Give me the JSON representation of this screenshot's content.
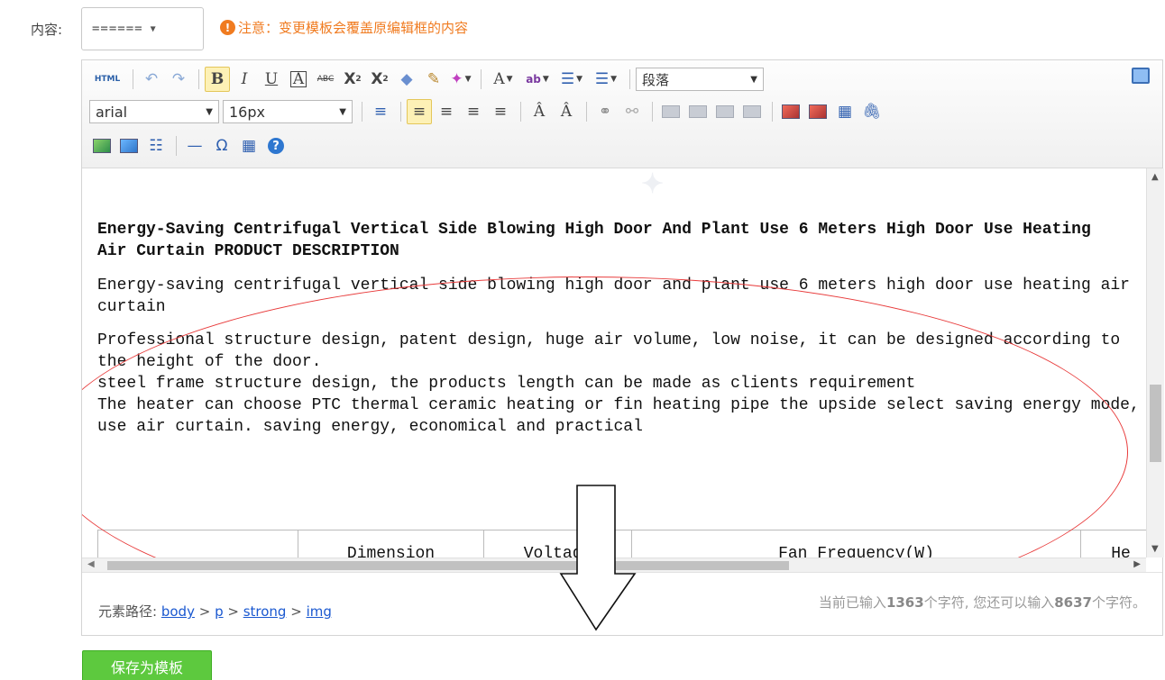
{
  "form": {
    "content_label": "内容:",
    "template_select_value": "======",
    "warning_text": "注意：变更模板会覆盖原编辑框的内容",
    "save_template_button": "保存为模板"
  },
  "toolbar": {
    "row1": [
      {
        "name": "html-source-button",
        "glyph": "HTML"
      },
      {
        "name": "undo-button",
        "glyph": "↶"
      },
      {
        "name": "redo-button",
        "glyph": "↷"
      },
      {
        "name": "bold-button",
        "glyph": "B"
      },
      {
        "name": "italic-button",
        "glyph": "I"
      },
      {
        "name": "underline-button",
        "glyph": "U"
      },
      {
        "name": "font-border-button",
        "glyph": "A"
      },
      {
        "name": "strikethrough-button",
        "glyph": "ABC"
      },
      {
        "name": "superscript-button",
        "glyph": "X²"
      },
      {
        "name": "subscript-button",
        "glyph": "X₂"
      },
      {
        "name": "eraser-button",
        "glyph": "⌫"
      },
      {
        "name": "format-painter-button",
        "glyph": "🖌"
      },
      {
        "name": "auto-format-button",
        "glyph": "✦"
      }
    ],
    "paragraph_select": "段落",
    "font_family_select": "arial",
    "font_size_select": "16px"
  },
  "content": {
    "heading": "Energy-Saving Centrifugal Vertical Side Blowing High Door And Plant Use 6 Meters High Door Use Heating Air Curtain PRODUCT DESCRIPTION",
    "paragraph1": "Energy-saving centrifugal vertical side blowing high door and plant use 6 meters high door use heating air curtain",
    "paragraph2": "Professional structure design, patent design, huge air volume, low noise, it can be designed according to the height of the door.",
    "paragraph3": "steel frame structure design, the products length can be made as clients requirement",
    "paragraph4": "The heater can choose PTC thermal ceramic heating or fin heating pipe the upside select saving energy mode, use air curtain. saving energy, economical and practical",
    "table_headers": [
      "",
      "Dimension",
      "Voltage",
      "Fan Frequency(W)",
      "He"
    ]
  },
  "statusbar": {
    "path_label": "元素路径:",
    "path": [
      "body",
      "p",
      "strong",
      "img"
    ],
    "count_prefix": "当前已输入",
    "count_typed": "1363",
    "count_mid": "个字符, 您还可以输入",
    "count_remaining": "8637",
    "count_suffix": "个字符。"
  },
  "colors": {
    "warning": "#f07b20",
    "annotation": "#e83b3b",
    "save_button": "#5dc93e",
    "link": "#1a58d0"
  }
}
